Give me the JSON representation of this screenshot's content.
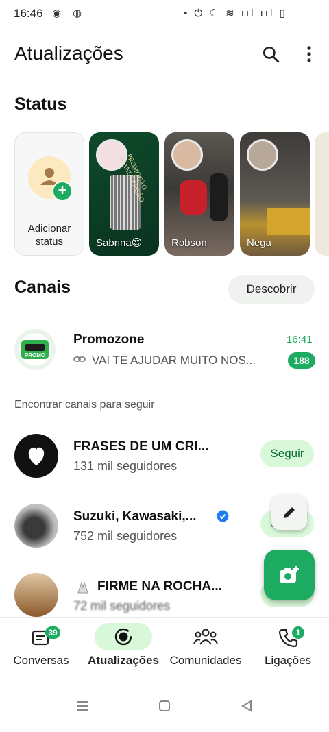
{
  "statusbar": {
    "time": "16:46",
    "right_icons": "• ⏻ ☾ ≋ ııl ııl ▯"
  },
  "header": {
    "title": "Atualizações"
  },
  "status": {
    "title": "Status",
    "add_label_1": "Adicionar",
    "add_label_2": "status",
    "cards": [
      {
        "name": "Sabrina😍"
      },
      {
        "name": "Robson"
      },
      {
        "name": "Nega"
      }
    ],
    "card1_text": "PROMOÇÃO MANUTENÇÃO"
  },
  "channels": {
    "title": "Canais",
    "discover_label": "Descobrir",
    "subscribed": {
      "name": "Promozone",
      "time": "16:41",
      "preview": "VAI TE AJUDAR MUITO NOS...",
      "unread": "188"
    },
    "find_label": "Encontrar canais para seguir",
    "follow_label": "Seguir",
    "suggested": [
      {
        "name": "FRASES DE UM CRI...",
        "followers": "131 mil seguidores"
      },
      {
        "name": "Suzuki, Kawasaki,...",
        "followers": "752 mil seguidores",
        "verified": true
      },
      {
        "name": "FIRME NA ROCHA...",
        "followers": "72 mil seguidores"
      }
    ]
  },
  "nav": {
    "items": [
      {
        "label": "Conversas",
        "badge": "39",
        "icon": "chat-icon"
      },
      {
        "label": "Atualizações",
        "icon": "updates-icon",
        "active": true
      },
      {
        "label": "Comunidades",
        "icon": "communities-icon"
      },
      {
        "label": "Ligações",
        "badge": "1",
        "icon": "phone-icon"
      }
    ]
  },
  "colors": {
    "accent": "#1daa61",
    "accent_light": "#d9f8d9",
    "badge_text": "#ffffff",
    "time_green": "#1daa61"
  }
}
